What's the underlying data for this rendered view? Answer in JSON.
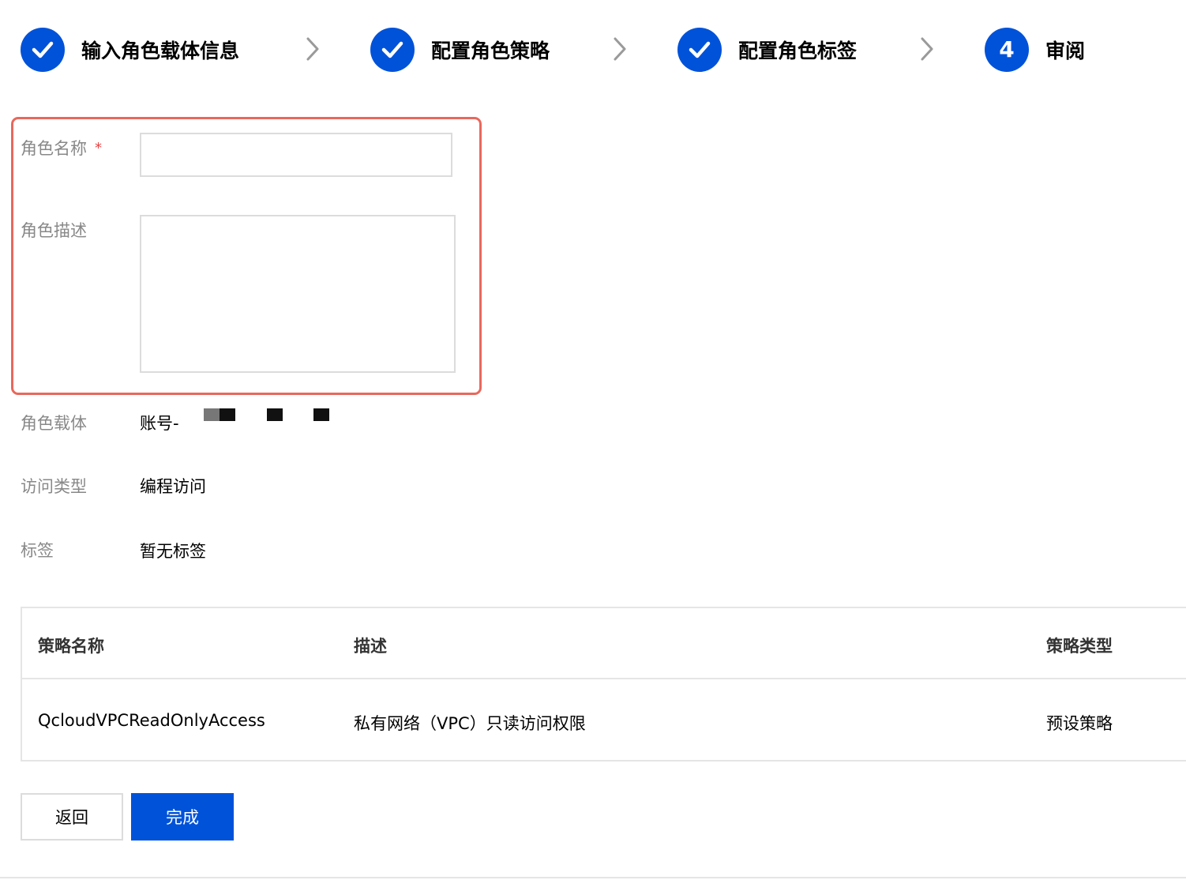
{
  "steps": [
    {
      "label": "输入角色载体信息",
      "status": "done",
      "icon": "check-icon"
    },
    {
      "label": "配置角色策略",
      "status": "done",
      "icon": "check-icon"
    },
    {
      "label": "配置角色标签",
      "status": "done",
      "icon": "check-icon"
    },
    {
      "label": "审阅",
      "status": "current",
      "number": "4"
    }
  ],
  "form": {
    "role_name": {
      "label": "角色名称",
      "required_mark": "*",
      "value": ""
    },
    "role_description": {
      "label": "角色描述",
      "value": ""
    },
    "role_carrier": {
      "label": "角色载体",
      "value": "账号-"
    },
    "access_type": {
      "label": "访问类型",
      "value": "编程访问"
    },
    "tags": {
      "label": "标签",
      "value": "暂无标签"
    }
  },
  "policy_table": {
    "columns": [
      "策略名称",
      "描述",
      "策略类型"
    ],
    "rows": [
      {
        "name": "QcloudVPCReadOnlyAccess",
        "description": "私有网络（VPC）只读访问权限",
        "type": "预设策略"
      }
    ]
  },
  "buttons": {
    "back": "返回",
    "finish": "完成"
  },
  "colors": {
    "primary": "#0052d9",
    "highlight_border": "#e8685c",
    "required": "#e54545",
    "label_gray": "#888888"
  }
}
